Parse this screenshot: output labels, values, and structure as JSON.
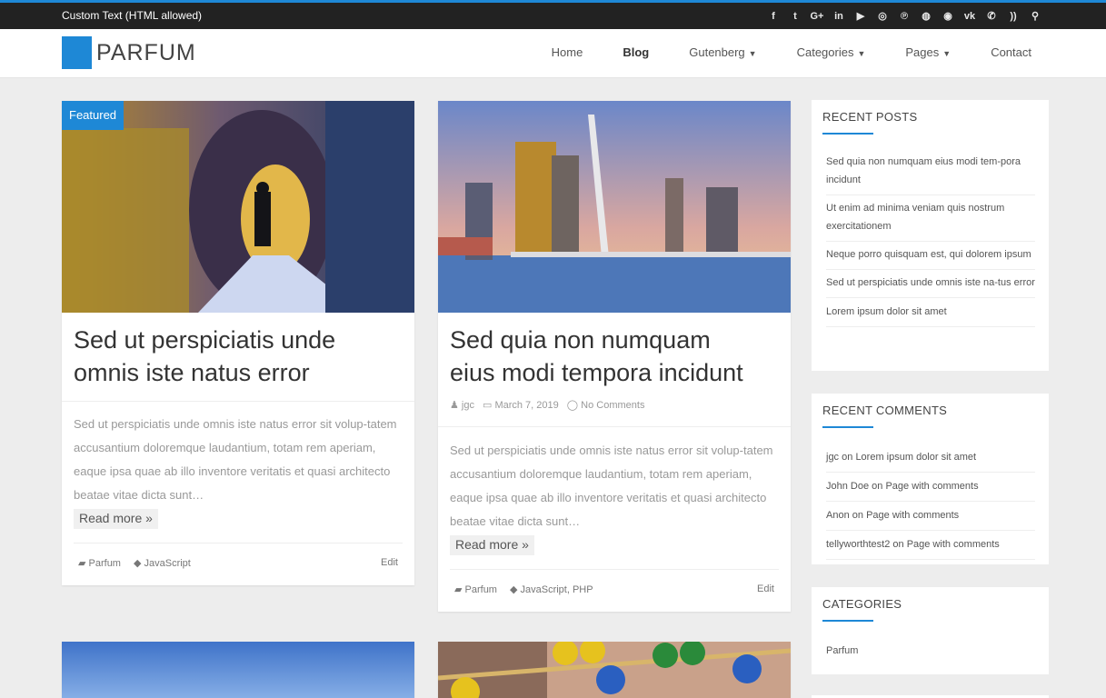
{
  "topbar": {
    "text": "Custom Text (HTML allowed)",
    "icons": [
      "facebook-icon",
      "twitter-icon",
      "google-plus-icon",
      "linkedin-icon",
      "youtube-icon",
      "instagram-icon",
      "pinterest-icon",
      "dribbble-icon",
      "reddit-icon",
      "vk-icon",
      "whatsapp-icon",
      "rss-icon",
      "search-icon"
    ]
  },
  "header": {
    "logo_text": "PARFUM",
    "nav": [
      {
        "label": "Home"
      },
      {
        "label": "Blog"
      },
      {
        "label": "Gutenberg"
      },
      {
        "label": "Categories"
      },
      {
        "label": "Pages"
      },
      {
        "label": "Contact"
      }
    ]
  },
  "posts": [
    {
      "badge": "Featured",
      "title_line1": "Sed ut perspiciatis unde",
      "title_line2": "omnis iste natus error",
      "excerpt": "Sed ut perspiciatis unde omnis iste natus error sit volup-tatem accusantium doloremque laudantium, totam rem aperiam, eaque ipsa quae ab illo inventore veritatis et quasi architecto beatae vitae dicta sunt…",
      "read_more": "Read more »",
      "category": "Parfum",
      "tags": "JavaScript",
      "edit": "Edit"
    },
    {
      "title_line1": "Sed quia non numquam",
      "title_line2": "eius modi tempora incidunt",
      "author": "jgc",
      "date": "March 7, 2019",
      "comments": "No Comments",
      "excerpt": "Sed ut perspiciatis unde omnis iste natus error sit volup-tatem accusantium doloremque laudantium, totam rem aperiam, eaque ipsa quae ab illo inventore veritatis et quasi architecto beatae vitae dicta sunt…",
      "read_more": "Read more »",
      "category": "Parfum",
      "tags": "JavaScript, PHP",
      "edit": "Edit"
    }
  ],
  "sidebar": {
    "recent_posts": {
      "title": "RECENT POSTS",
      "items": [
        "Sed quia non numquam eius modi tem-pora incidunt",
        "Ut enim ad minima veniam quis nostrum exercitationem",
        "Neque porro quisquam est, qui dolorem ipsum",
        "Sed ut perspiciatis unde omnis iste na-tus error",
        "Lorem ipsum dolor sit amet"
      ]
    },
    "recent_comments": {
      "title": "RECENT COMMENTS",
      "items": [
        {
          "author": "jgc",
          "on": "on",
          "post": "Lorem ipsum dolor sit amet"
        },
        {
          "author": "John Doe",
          "on": "on",
          "post": "Page with comments"
        },
        {
          "author": "Anon",
          "on": "on",
          "post": "Page with comments"
        },
        {
          "author": "tellyworthtest2",
          "on": "on",
          "post": "Page with comments"
        }
      ]
    },
    "categories": {
      "title": "CATEGORIES",
      "items": [
        "Parfum"
      ]
    }
  },
  "colors": {
    "accent": "#1e88d6",
    "topbar": "#222222",
    "background": "#ededed"
  }
}
